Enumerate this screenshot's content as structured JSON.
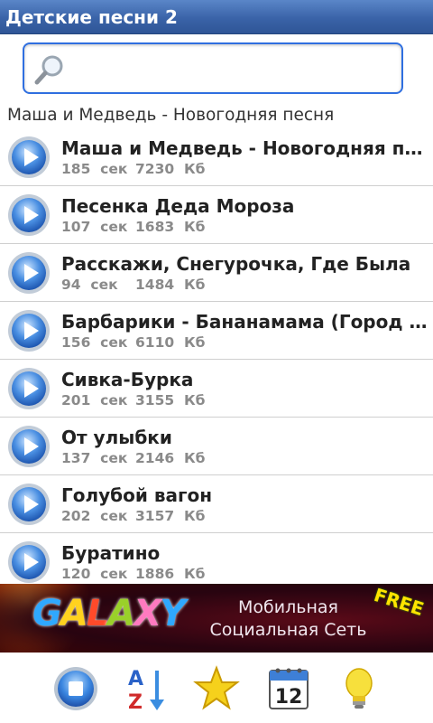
{
  "app": {
    "title": "Детские песни 2"
  },
  "search": {
    "value": "",
    "placeholder": ""
  },
  "now_playing": "Маша и Медведь - Новогодняя песня",
  "songs": [
    {
      "title": "Маша и Медведь - Новогодняя песня",
      "duration": "185",
      "size": "7230"
    },
    {
      "title": "Песенка Деда Мороза",
      "duration": "107",
      "size": "1683"
    },
    {
      "title": "Расскажи, Снегурочка, Где Была",
      "duration": "94",
      "size": "1484"
    },
    {
      "title": "Барбарики - Бананамама (Город детства)",
      "duration": "156",
      "size": "6110"
    },
    {
      "title": "Сивка-Бурка",
      "duration": "201",
      "size": "3155"
    },
    {
      "title": "От улыбки",
      "duration": "137",
      "size": "2146"
    },
    {
      "title": "Голубой вагон",
      "duration": "202",
      "size": "3157"
    },
    {
      "title": "Буратино",
      "duration": "120",
      "size": "1886"
    }
  ],
  "units": {
    "sec": "сек",
    "kb": "Кб"
  },
  "banner": {
    "logo": "GALAXY",
    "line1": "Мобильная",
    "line2": "Социальная Сеть",
    "badge": "FREE"
  },
  "calendar_day": "12",
  "colors": {
    "title_bar": "#3a63a8",
    "search_border": "#2f6fe0",
    "play_button": "#2f6fd0"
  }
}
